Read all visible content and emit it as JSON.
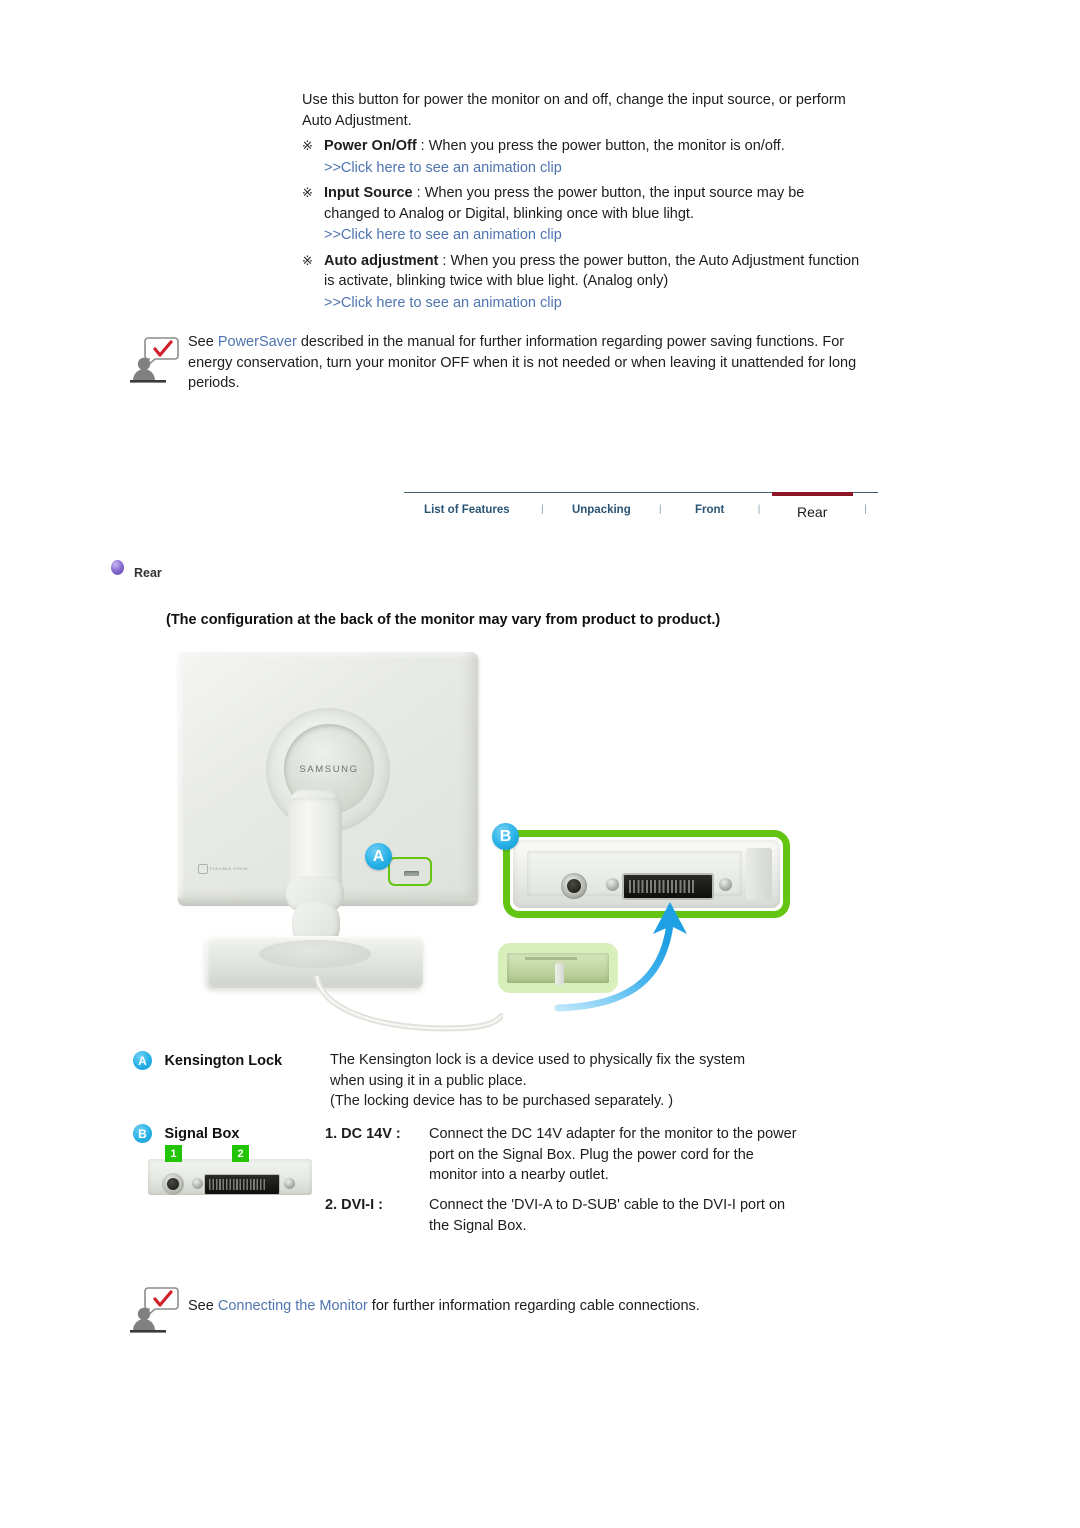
{
  "top": {
    "lead": "Use this button for power the monitor on and off, change the input source, or perform Auto Adjustment.",
    "bullets": [
      {
        "mark": "※",
        "term": "Power On/Off",
        "text": " : When you press the power button, the monitor is on/off.",
        "link": ">>Click here to see an animation clip"
      },
      {
        "mark": "※",
        "term": "Input Source",
        "text": " : When you press the power button, the input source may be changed to Analog or Digital, blinking once with blue lihgt.",
        "link": ">>Click here to see an animation clip"
      },
      {
        "mark": "※",
        "term": "Auto adjustment",
        "text": " : When you press the power button, the Auto Adjustment function is activate, blinking twice with blue light. (Analog only)",
        "link": ">>Click here to see an animation clip"
      }
    ]
  },
  "note_powersaver": {
    "icon": "person-speech-check-icon",
    "pre": "See ",
    "link": "PowerSaver",
    "post": " described in the manual for further information regarding power saving functions. For energy conservation, turn your monitor OFF when it is not needed or when leaving it unattended for long periods."
  },
  "tabs": [
    {
      "label": "List of Features",
      "active": false
    },
    {
      "label": "Unpacking",
      "active": false
    },
    {
      "label": "Front",
      "active": false
    },
    {
      "label": "Rear",
      "active": true
    }
  ],
  "tab_separator": "|",
  "section": {
    "bullet_icon": "purple-sphere-bullet-icon",
    "title": "Rear",
    "config_note": "(The configuration at the back of the monitor may vary from product to product.)"
  },
  "figure": {
    "brand_logo": "SAMSUNG",
    "hinge_label": "FLEXIBLE HINGE",
    "marker_a": "A",
    "marker_b": "B",
    "arrow": "blue-curved-arrow-icon"
  },
  "legend": {
    "items": [
      {
        "badge": "A",
        "label": "Kensington Lock",
        "lines": [
          "The Kensington lock is a device used to physically fix the system",
          "when using it in a public place.",
          "(The locking device has to be purchased separately. )"
        ]
      },
      {
        "badge": "B",
        "label": "Signal Box",
        "entries": [
          {
            "num": "1. DC 14V :",
            "lines": [
              "Connect the DC 14V adapter for the monitor to the power",
              "port on the Signal Box. Plug the power cord for the",
              "monitor into a nearby outlet."
            ]
          },
          {
            "num": "2. DVI-I :",
            "lines": [
              "Connect the 'DVI-A to D-SUB' cable to the DVI-I port on",
              "the Signal Box."
            ]
          }
        ],
        "thumb_badges": [
          "1",
          "2"
        ]
      }
    ]
  },
  "note_connecting": {
    "icon": "person-speech-check-icon",
    "pre": "See ",
    "link": "Connecting the Monitor",
    "post": " for further information regarding cable connections."
  },
  "colors": {
    "link": "#4f74b0",
    "tab_text": "#2a5474",
    "tab_active_underline": "#8e1524",
    "tab_rule": "#41606e",
    "marker_blue": "#27b0e6",
    "highlight_green": "#63c511",
    "badge_green": "#22c406",
    "bullet_purple": "#7a5cc4"
  }
}
